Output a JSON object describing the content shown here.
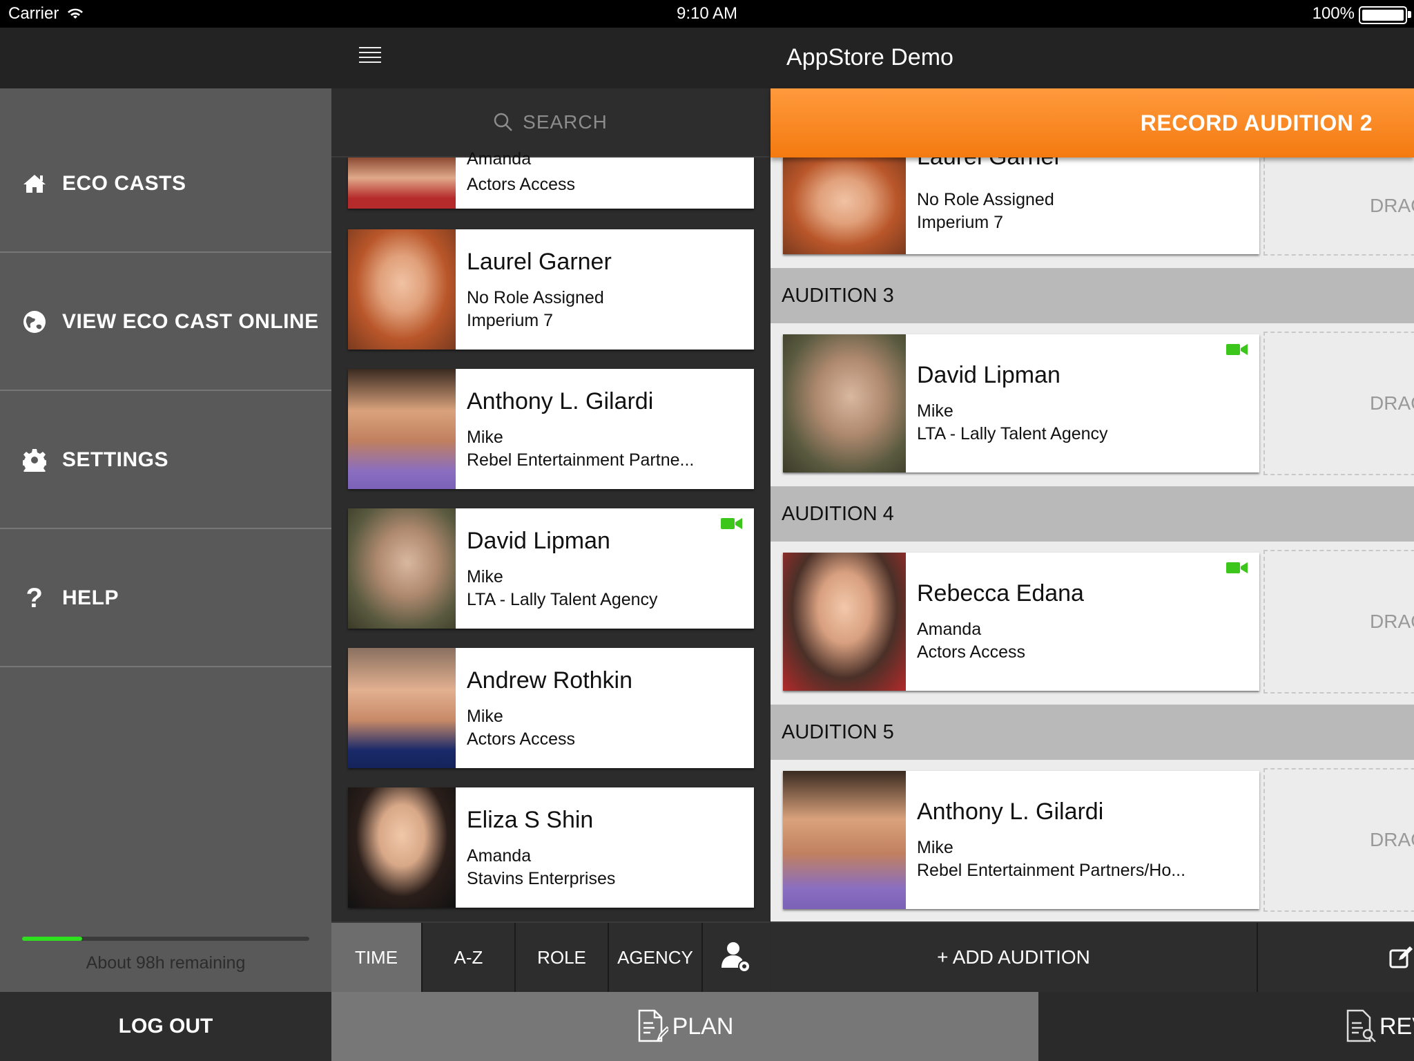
{
  "status_bar": {
    "carrier": "Carrier",
    "time": "9:10 AM",
    "battery": "100%"
  },
  "app": {
    "title": "AppStore Demo"
  },
  "sidebar": {
    "items": [
      {
        "label": "ECO CASTS",
        "icon": "home-icon"
      },
      {
        "label": "VIEW ECO CAST ONLINE",
        "icon": "globe-icon"
      },
      {
        "label": "SETTINGS",
        "icon": "gear-icon"
      },
      {
        "label": "HELP",
        "icon": "question-icon"
      }
    ],
    "storage_fraction": 0.21,
    "remaining": "About 98h remaining",
    "logout": "LOG OUT"
  },
  "search": {
    "placeholder": "SEARCH"
  },
  "talent_list": [
    {
      "name": "Amanda",
      "role": "",
      "agency": "Actors Access",
      "partial": true
    },
    {
      "name": "Laurel Garner",
      "role": "No Role Assigned",
      "agency": "Imperium 7",
      "video": false
    },
    {
      "name": "Anthony L. Gilardi",
      "role": "Mike",
      "agency": "Rebel Entertainment Partne...",
      "video": false
    },
    {
      "name": "David Lipman",
      "role": "Mike",
      "agency": "LTA - Lally Talent Agency",
      "video": true
    },
    {
      "name": "Andrew Rothkin",
      "role": "Mike",
      "agency": "Actors Access",
      "video": false
    },
    {
      "name": "Eliza S Shin",
      "role": "Amanda",
      "agency": "Stavins Enterprises",
      "video": false
    }
  ],
  "record_button": "RECORD AUDITION 2",
  "auditions": {
    "top_card": {
      "name": "Laurel Garner",
      "role": "No Role Assigned",
      "agency": "Imperium 7"
    },
    "groups": [
      {
        "title": "AUDITION 3",
        "name": "David Lipman",
        "role": "Mike",
        "agency": "LTA - Lally Talent Agency",
        "video": true
      },
      {
        "title": "AUDITION 4",
        "name": "Rebecca Edana",
        "role": "Amanda",
        "agency": "Actors Access",
        "video": true
      },
      {
        "title": "AUDITION 5",
        "name": "Anthony L. Gilardi",
        "role": "Mike",
        "agency": "Rebel Entertainment Partners/Ho...",
        "video": false
      }
    ],
    "drop_label": "DRAG"
  },
  "sort_tabs": [
    "TIME",
    "A-Z",
    "ROLE",
    "AGENCY"
  ],
  "sort_active": "TIME",
  "add_audition": "+ ADD AUDITION",
  "bottom_tabs": {
    "plan": "PLAN",
    "review": "REVIEW"
  },
  "colors": {
    "accent_orange": "#f47a10",
    "video_green": "#3cc51a",
    "progress_green": "#2fe01f"
  }
}
